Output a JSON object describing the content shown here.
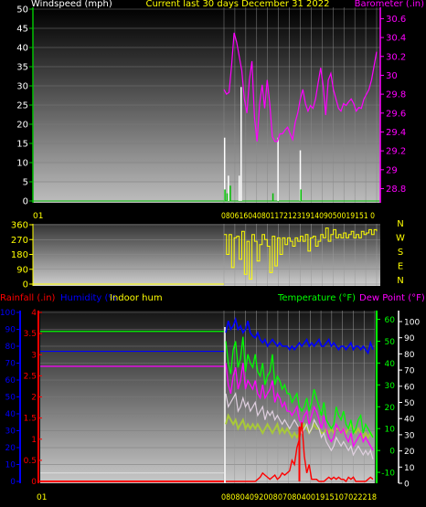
{
  "colors": {
    "wind": "#ffffff",
    "gust": "#00c000",
    "barometer": "#ff00ff",
    "direction": "#ffff00",
    "rainfall": "#ff0000",
    "humidity": "#0000ff",
    "indoor_hum": "#ffff00",
    "temperature": "#00ff00",
    "dewpoint": "#ff00ff",
    "indoor_temp": "#ffb0ff",
    "title": "#ffff00"
  },
  "chart_data": [
    {
      "id": "wind-baro",
      "type": "line",
      "title": "Current last 30 days December 31 2022",
      "ylabel_left": "Windspeed (mph)",
      "ylabel_right": "Barometer (.in)",
      "xlabel_left": "01",
      "xlabel_right": "080616040801172123191409050019151 0",
      "yticks_left": [
        "0",
        "5",
        "10",
        "15",
        "20",
        "25",
        "30",
        "35",
        "40",
        "45",
        "50"
      ],
      "ylim_left": [
        0,
        50
      ],
      "yticks_right": [
        "28.8",
        "29",
        "29.2",
        "29.4",
        "29.6",
        "29.8",
        "30",
        "30.2",
        "30.4",
        "30.6"
      ],
      "ylim_right": [
        28.65,
        30.72
      ],
      "x": [
        0,
        0.4,
        0.8,
        1.2,
        1.6,
        2.0,
        2.4,
        2.8,
        3.2,
        3.6,
        4.0,
        4.4,
        4.8,
        5.2,
        5.6,
        6.0,
        6.4,
        6.8,
        7.2,
        7.6,
        8.0,
        8.4,
        8.8,
        9.2,
        9.6,
        10.0,
        10.4,
        10.8,
        11.2,
        11.6,
        12.0,
        12.4,
        12.8,
        13.2,
        13.6,
        14.0,
        14.4,
        14.8,
        15.2,
        15.6,
        16.0,
        16.4,
        16.8,
        17.2,
        17.6,
        18.0,
        18.4,
        18.8,
        19.2,
        19.6,
        20.0,
        20.4,
        20.8,
        21.2,
        21.6,
        22.0,
        22.4,
        22.8,
        23.2,
        23.6,
        24.0
      ],
      "series": [
        {
          "name": "Barometer",
          "axis": "right",
          "values": [
            29.85,
            29.8,
            29.82,
            30.1,
            30.45,
            30.35,
            30.2,
            30.05,
            29.75,
            29.6,
            29.95,
            30.15,
            29.55,
            29.3,
            29.7,
            29.9,
            29.65,
            29.95,
            29.7,
            29.35,
            29.3,
            29.3,
            29.38,
            29.38,
            29.42,
            29.45,
            29.38,
            29.32,
            29.5,
            29.6,
            29.75,
            29.85,
            29.7,
            29.62,
            29.68,
            29.65,
            29.75,
            29.92,
            30.08,
            29.88,
            29.58,
            29.95,
            30.02,
            29.85,
            29.75,
            29.65,
            29.62,
            29.7,
            29.68,
            29.72,
            29.75,
            29.7,
            29.62,
            29.66,
            29.65,
            29.75,
            29.8,
            29.85,
            29.95,
            30.1,
            30.25
          ]
        },
        {
          "name": "Wind gust",
          "axis": "left",
          "values": [
            2,
            0,
            0,
            0,
            0,
            0,
            0,
            3,
            0,
            0,
            0,
            0,
            0,
            0,
            0,
            0,
            0,
            0,
            0,
            0,
            0,
            0,
            2,
            0,
            0,
            0,
            0,
            0,
            0,
            0,
            0,
            0,
            0,
            0,
            0,
            0,
            0,
            0,
            0,
            0,
            0,
            0,
            0,
            0,
            0,
            0,
            0,
            0,
            0,
            0,
            0,
            0,
            0,
            0,
            0,
            0,
            0,
            0,
            0,
            0,
            0
          ]
        }
      ],
      "wind_spikes": [
        {
          "x": 0.1,
          "v": 5
        },
        {
          "x": 0.7,
          "v": 2
        },
        {
          "x": 2.4,
          "v": 2
        },
        {
          "x": 2.7,
          "v": 9
        },
        {
          "x": 8.5,
          "v": 5
        },
        {
          "x": 12.0,
          "v": 4
        }
      ]
    },
    {
      "id": "direction",
      "type": "line",
      "ylabel_right_letters": [
        "N",
        "W",
        "S",
        "E",
        "N"
      ],
      "yticks_left": [
        "0",
        "90",
        "180",
        "270",
        "360"
      ],
      "ylim": [
        0,
        360
      ],
      "xlabel_left": "01",
      "values": [
        300,
        180,
        300,
        100,
        280,
        290,
        150,
        320,
        60,
        260,
        30,
        300,
        260,
        140,
        240,
        300,
        270,
        230,
        70,
        290,
        110,
        280,
        180,
        280,
        240,
        280,
        260,
        230,
        280,
        260,
        290,
        260,
        300,
        200,
        280,
        290,
        230,
        260,
        300,
        280,
        340,
        260,
        300,
        330,
        280,
        300,
        280,
        310,
        280,
        300,
        320,
        280,
        300,
        280,
        320,
        300,
        310,
        330,
        300,
        330,
        320
      ]
    },
    {
      "id": "temp-rain-hum",
      "type": "line",
      "labels": {
        "rainfall": "Rainfall (.in)",
        "humidity": "Humidity (%",
        "indoor_hum": "Indoor hum",
        "temperature": "Temperature (°F)",
        "dewpoint": "Dew Point (°F)"
      },
      "xlabel_left": "01",
      "xlabel_right": "080804092008070804001915107022218",
      "yticks_rain": [
        "0",
        "0.5",
        "1",
        "1.5",
        "2",
        "2.5",
        "3",
        "3.5",
        "4"
      ],
      "ylim_rain": [
        0,
        4
      ],
      "yticks_hum": [
        "0",
        "10",
        "20",
        "30",
        "40",
        "50",
        "60",
        "70",
        "80",
        "90",
        "100"
      ],
      "ylim_hum": [
        0,
        100
      ],
      "yticks_temp": [
        "-10",
        "0",
        "10",
        "20",
        "30",
        "40",
        "50",
        "60"
      ],
      "ylim_temp": [
        -15,
        64
      ],
      "yticks_temp_outer": [
        "0",
        "10",
        "20",
        "30",
        "40",
        "50",
        "60",
        "70",
        "80",
        "90",
        "100"
      ],
      "ref_lines": {
        "temperature": 54.5,
        "dewpoint": 38.5,
        "humidity": 77,
        "indoor_hum_white": 5
      },
      "series": [
        {
          "name": "Humidity",
          "values": [
            88,
            95,
            90,
            92,
            96,
            90,
            92,
            88,
            90,
            95,
            88,
            86,
            85,
            88,
            84,
            82,
            84,
            80,
            82,
            84,
            82,
            80,
            82,
            80,
            80,
            80,
            78,
            80,
            78,
            80,
            82,
            80,
            82,
            84,
            80,
            82,
            80,
            82,
            84,
            80,
            80,
            82,
            84,
            80,
            82,
            80,
            78,
            80,
            80,
            78,
            80,
            82,
            78,
            80,
            80,
            78,
            80,
            78,
            76,
            82,
            78
          ]
        },
        {
          "name": "Temperature",
          "values": [
            50,
            40,
            35,
            46,
            50,
            38,
            42,
            52,
            36,
            44,
            40,
            38,
            44,
            36,
            34,
            40,
            30,
            34,
            36,
            44,
            30,
            34,
            32,
            28,
            30,
            26,
            26,
            22,
            24,
            26,
            20,
            18,
            20,
            24,
            18,
            22,
            28,
            24,
            20,
            16,
            22,
            14,
            12,
            10,
            12,
            20,
            16,
            14,
            18,
            12,
            10,
            14,
            8,
            10,
            14,
            16,
            8,
            12,
            10,
            8,
            6
          ]
        },
        {
          "name": "Dew Point",
          "values": [
            40,
            30,
            26,
            34,
            38,
            28,
            32,
            40,
            28,
            32,
            30,
            28,
            32,
            26,
            24,
            30,
            24,
            26,
            28,
            32,
            22,
            26,
            24,
            20,
            22,
            18,
            18,
            16,
            18,
            20,
            14,
            12,
            16,
            18,
            12,
            16,
            20,
            18,
            14,
            10,
            16,
            10,
            6,
            4,
            6,
            12,
            10,
            8,
            10,
            6,
            4,
            8,
            2,
            4,
            6,
            8,
            4,
            6,
            4,
            2,
            0
          ]
        },
        {
          "name": "Outdoor",
          "values": [
            26,
            20,
            22,
            24,
            26,
            18,
            20,
            24,
            20,
            22,
            18,
            20,
            22,
            16,
            18,
            20,
            14,
            18,
            16,
            18,
            14,
            16,
            14,
            12,
            14,
            12,
            10,
            12,
            14,
            12,
            10,
            8,
            10,
            12,
            8,
            10,
            14,
            12,
            10,
            6,
            8,
            4,
            2,
            0,
            2,
            6,
            4,
            2,
            4,
            2,
            0,
            2,
            -2,
            0,
            2,
            0,
            -2,
            0,
            -2,
            0,
            -4
          ]
        },
        {
          "name": "Indoor",
          "values": [
            12,
            16,
            14,
            12,
            14,
            10,
            12,
            14,
            10,
            12,
            10,
            12,
            10,
            12,
            10,
            8,
            10,
            12,
            10,
            8,
            10,
            12,
            8,
            10,
            8,
            10,
            8,
            6,
            8,
            6,
            8,
            10,
            12,
            10,
            8,
            10,
            12,
            10,
            10,
            8,
            8,
            10,
            8,
            10,
            8,
            10,
            10,
            8,
            10,
            8,
            10,
            12,
            10,
            8,
            10,
            8,
            6,
            8,
            6,
            8,
            6
          ]
        },
        {
          "name": "Rainfall",
          "values": [
            0,
            0,
            0,
            0,
            0,
            0,
            0,
            0,
            0,
            0,
            0,
            0,
            0,
            0.05,
            0.1,
            0.2,
            0.15,
            0.1,
            0.05,
            0.1,
            0.15,
            0.05,
            0.1,
            0.2,
            0.15,
            0.2,
            0.25,
            0.5,
            0.4,
            0.8,
            1.0,
            1.4,
            0.6,
            0.2,
            0.4,
            0.05,
            0.05,
            0.05,
            0,
            0,
            0,
            0.05,
            0.1,
            0.05,
            0.1,
            0.05,
            0.1,
            0.05,
            0.05,
            0,
            0.1,
            0.05,
            0.1,
            0,
            0,
            0,
            0,
            0,
            0.05,
            0.1,
            0.05
          ]
        }
      ],
      "rain_big": [
        {
          "x": 30,
          "v": 1.3
        }
      ]
    }
  ]
}
